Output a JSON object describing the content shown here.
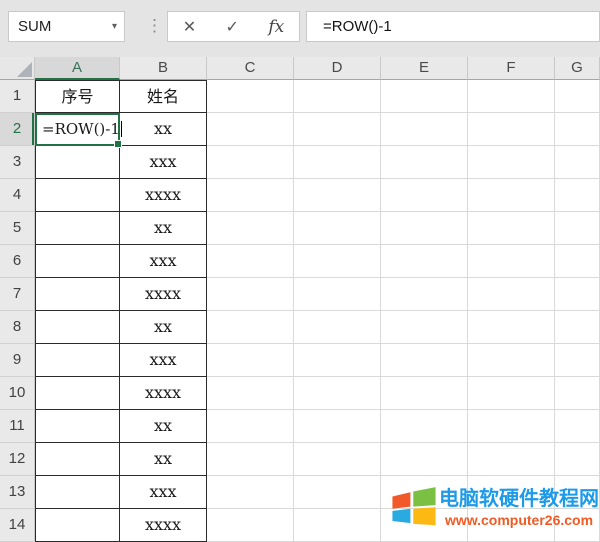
{
  "formula_bar": {
    "name_box_value": "SUM",
    "formula": "=ROW()-1"
  },
  "icons": {
    "dropdown": "▾",
    "more_handle": "⋮",
    "cancel": "✕",
    "enter": "✓",
    "insert_function": "fx"
  },
  "grid": {
    "column_headers": [
      "A",
      "B",
      "C",
      "D",
      "E",
      "F",
      "G"
    ],
    "selected_column": "A",
    "selected_row_number": 2,
    "editing_cell": {
      "address": "A2",
      "value": "=ROW()-1"
    },
    "rows": [
      {
        "n": 1,
        "A": "序号",
        "B": "姓名"
      },
      {
        "n": 2,
        "A": "=ROW()-1",
        "B": "xx"
      },
      {
        "n": 3,
        "A": "",
        "B": "xxx"
      },
      {
        "n": 4,
        "A": "",
        "B": "xxxx"
      },
      {
        "n": 5,
        "A": "",
        "B": "xx"
      },
      {
        "n": 6,
        "A": "",
        "B": "xxx"
      },
      {
        "n": 7,
        "A": "",
        "B": "xxxx"
      },
      {
        "n": 8,
        "A": "",
        "B": "xx"
      },
      {
        "n": 9,
        "A": "",
        "B": "xxx"
      },
      {
        "n": 10,
        "A": "",
        "B": "xxxx"
      },
      {
        "n": 11,
        "A": "",
        "B": "xx"
      },
      {
        "n": 12,
        "A": "",
        "B": "xx"
      },
      {
        "n": 13,
        "A": "",
        "B": "xxx"
      },
      {
        "n": 14,
        "A": "",
        "B": "xxxx"
      }
    ]
  },
  "watermark": {
    "site_name": "电脑软硬件教程网",
    "site_url": "www.computer26.com",
    "logo": "windows-flag",
    "colors": {
      "site_name": "#1D9BE8",
      "site_url": "#F15A24",
      "tile_top_left": "#F1592A",
      "tile_top_right": "#7AC143",
      "tile_bottom_left": "#29ABE2",
      "tile_bottom_right": "#FDB913"
    }
  },
  "colors": {
    "accent_green": "#217346",
    "table_border": "#2B2B2B",
    "gridline": "#D9D9D9"
  }
}
